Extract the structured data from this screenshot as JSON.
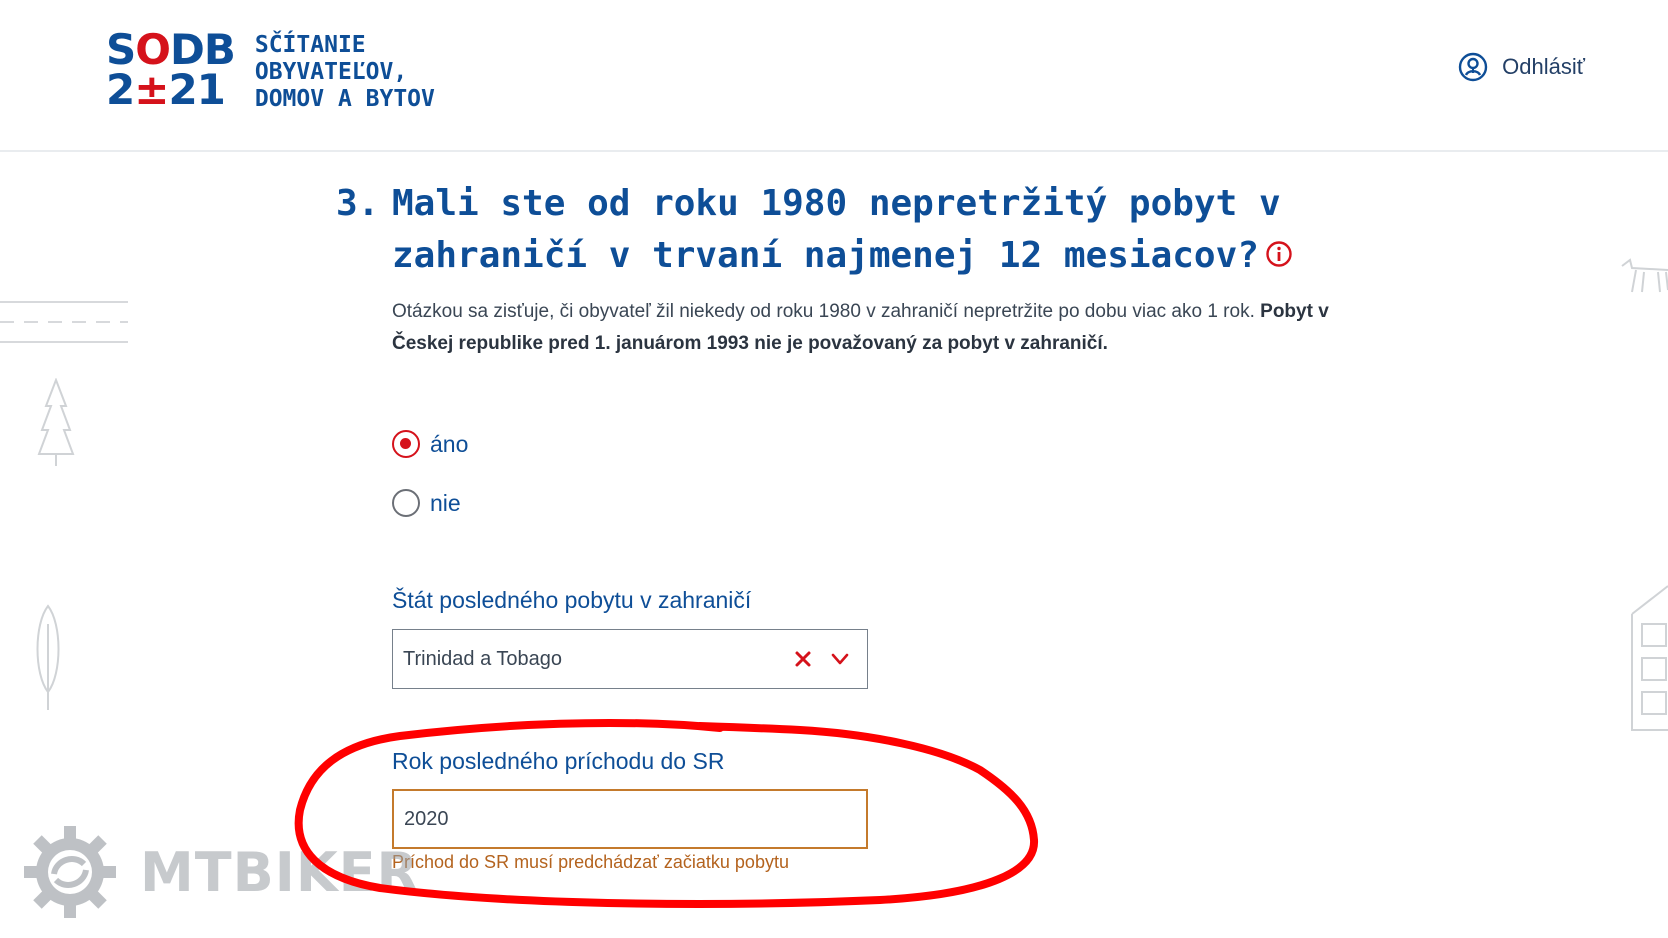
{
  "header": {
    "logo_line1": "SODB",
    "logo_line2": "2±21",
    "logo_text": [
      "SČÍTANIE",
      "OBYVATEĽOV,",
      "DOMOV A BYTOV"
    ],
    "logout_label": "Odhlásiť"
  },
  "question": {
    "number": "3.",
    "title": "Mali ste od roku 1980 nepretržitý pobyt v zahraničí v trvaní najmenej 12 mesiacov?",
    "description_normal": "Otázkou sa zisťuje, či obyvateľ žil niekedy od roku 1980 v zahraničí nepretržite po dobu viac ako 1 rok.",
    "description_bold": "Pobyt v Českej republike pred 1. januárom 1993 nie je považovaný za pobyt v zahraničí."
  },
  "options": [
    {
      "label": "áno",
      "selected": true
    },
    {
      "label": "nie",
      "selected": false
    }
  ],
  "country_field": {
    "label": "Štát posledného pobytu v zahraničí",
    "value": "Trinidad a Tobago"
  },
  "year_field": {
    "label": "Rok posledného príchodu do SR",
    "value": "2020",
    "error": "Príchod do SR musí predchádzať začiatku pobytu"
  },
  "watermark": {
    "text": "MTBIKER"
  },
  "colors": {
    "primary": "#0e4e97",
    "accent": "#d5121b",
    "error": "#b4631e",
    "annotation": "#ff0000"
  },
  "icons": [
    "user-circle-icon",
    "info-icon",
    "clear-icon",
    "chevron-down-icon",
    "gear-logo-icon"
  ]
}
